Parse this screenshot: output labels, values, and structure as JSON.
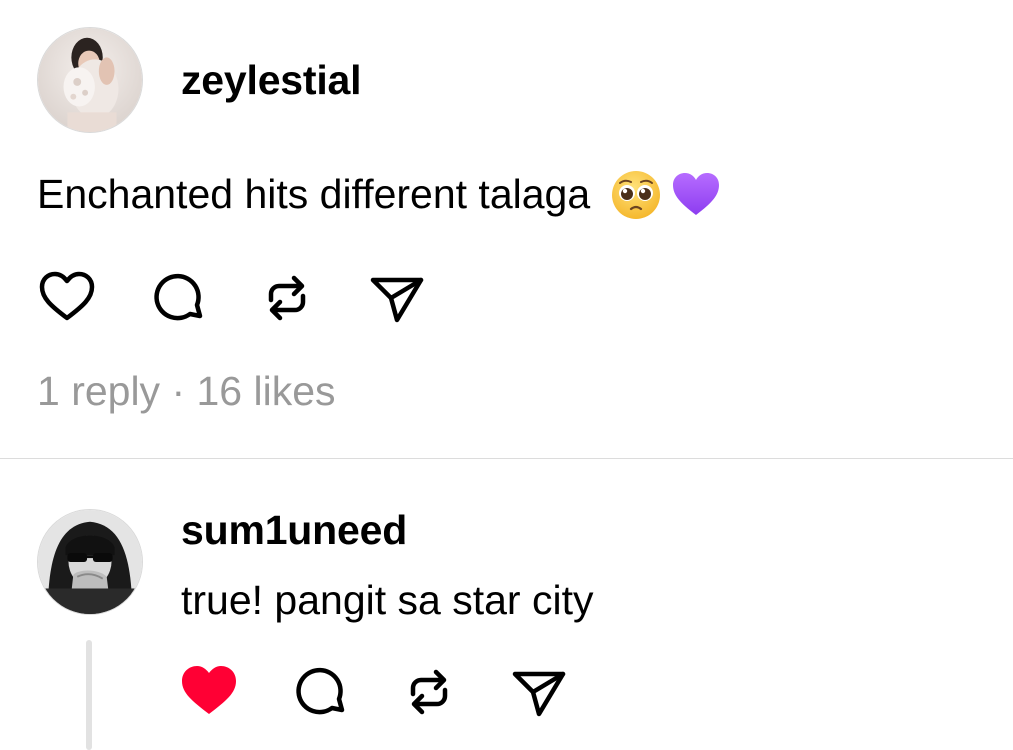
{
  "post": {
    "username": "zeylestial",
    "text": "Enchanted hits different talaga",
    "emojis": [
      "pleading-face-emoji",
      "purple-heart-emoji"
    ],
    "replies_label": "1 reply",
    "separator": " · ",
    "likes_label": "16 likes",
    "liked": false
  },
  "reply": {
    "username": "sum1uneed",
    "text": "true! pangit sa star city",
    "liked": true
  },
  "colors": {
    "text": "#000000",
    "muted": "#999999",
    "like_active": "#ff0034",
    "divider": "#dcdcdc",
    "thread_line": "#e2e2e2"
  },
  "icons": {
    "like": "heart-icon",
    "comment": "comment-icon",
    "repost": "repost-icon",
    "share": "send-icon"
  }
}
